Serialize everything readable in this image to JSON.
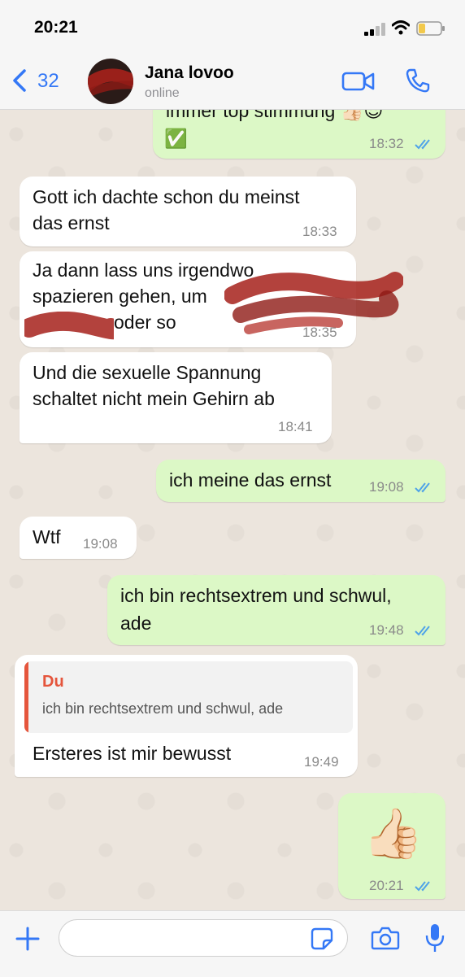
{
  "status_bar": {
    "time": "20:21"
  },
  "header": {
    "back_count": "32",
    "contact_name": "Jana lovoo",
    "contact_status": "online"
  },
  "messages": [
    {
      "direction": "outgoing",
      "text": "immer top stimmung 👍🏻😎",
      "text2": "✅",
      "time": "18:32",
      "read": true
    },
    {
      "direction": "incoming",
      "text": "Gott ich dachte schon du meinst",
      "text2": "das ernst",
      "time": "18:33"
    },
    {
      "direction": "incoming",
      "text": "Ja dann lass uns irgendwo",
      "text2": "spazieren gehen, um",
      "text3": "oder so",
      "time": "18:35"
    },
    {
      "direction": "incoming",
      "text": "Und die sexuelle Spannung",
      "text2": "schaltet nicht mein Gehirn ab",
      "time": "18:41"
    },
    {
      "direction": "outgoing",
      "text": "ich meine das ernst",
      "time": "19:08",
      "read": true
    },
    {
      "direction": "incoming",
      "text": "Wtf",
      "time": "19:08"
    },
    {
      "direction": "outgoing",
      "text": "ich bin rechtsextrem und schwul,",
      "text2": "ade",
      "time": "19:48",
      "read": true
    },
    {
      "direction": "incoming",
      "reply_to": {
        "name": "Du",
        "text": "ich bin rechtsextrem und schwul, ade"
      },
      "text": "Ersteres ist mir bewusst",
      "time": "19:49"
    },
    {
      "direction": "outgoing",
      "emoji": "👍🏻",
      "time": "20:21",
      "read": true
    }
  ],
  "colors": {
    "accent": "#3478f6",
    "outgoing_bubble": "#dcf8c6",
    "incoming_bubble": "#ffffff",
    "reply_accent": "#e5553c",
    "read_ticks": "#4fa3e8"
  },
  "icons": [
    "back-chevron-icon",
    "video-call-icon",
    "phone-icon",
    "plus-icon",
    "sticker-icon",
    "camera-icon",
    "microphone-icon"
  ],
  "input": {
    "placeholder": ""
  }
}
